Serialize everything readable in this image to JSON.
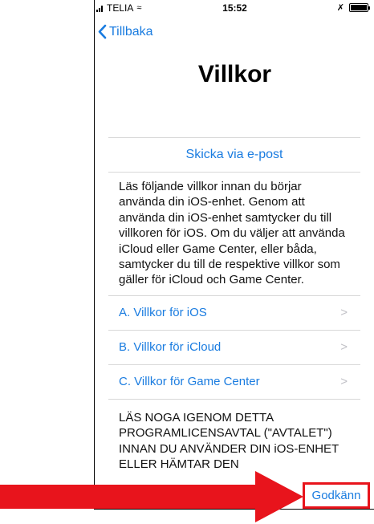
{
  "status_bar": {
    "carrier": "TELIA",
    "time": "15:52"
  },
  "nav": {
    "back_label": "Tillbaka"
  },
  "page": {
    "title": "Villkor"
  },
  "terms": {
    "email_link": "Skicka via e-post",
    "intro": "Läs följande villkor innan du börjar använda din iOS-enhet. Genom att använda din iOS-enhet samtycker du till villkoren för iOS. Om du väljer att använda iCloud eller Game Center, eller båda, samtycker du till de respektive villkor som gäller för iCloud och Game Center.",
    "items": [
      {
        "label": "A. Villkor för iOS"
      },
      {
        "label": "B. Villkor för iCloud"
      },
      {
        "label": "C. Villkor för Game Center"
      }
    ],
    "license_text": "LÄS NOGA IGENOM DETTA PROGRAMLICENSAVTAL (\"AVTALET\") INNAN DU ANVÄNDER DIN iOS-ENHET ELLER HÄMTAR DEN"
  },
  "footer": {
    "agree_label": "Godkänn"
  },
  "colors": {
    "link": "#1a7ce0",
    "highlight": "#e8141c"
  },
  "icons": {
    "back": "chevron-left-icon",
    "row": "chevron-right-icon",
    "annotation": "arrow-right-icon"
  }
}
